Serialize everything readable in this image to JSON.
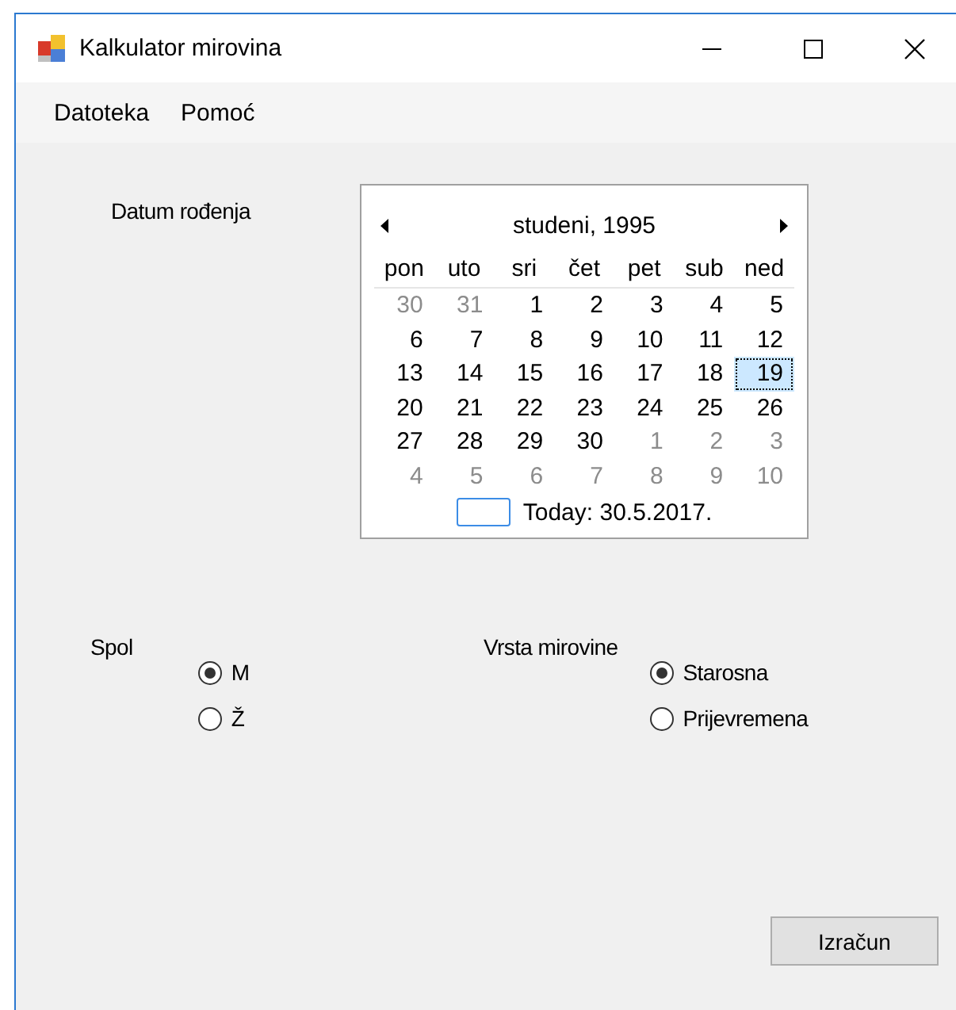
{
  "window": {
    "title": "Kalkulator mirovina"
  },
  "menu": [
    "Datoteka",
    "Pomoć"
  ],
  "birth_date": {
    "label": "Datum rođenja",
    "calendar": {
      "month": "studeni, 1995",
      "weekdays": [
        "pon",
        "uto",
        "sri",
        "čet",
        "pet",
        "sub",
        "ned"
      ],
      "weeks": [
        [
          {
            "day": "30",
            "muted": true,
            "selected": false
          },
          {
            "day": "31",
            "muted": true,
            "selected": false
          },
          {
            "day": "1",
            "muted": false,
            "selected": false
          },
          {
            "day": "2",
            "muted": false,
            "selected": false
          },
          {
            "day": "3",
            "muted": false,
            "selected": false
          },
          {
            "day": "4",
            "muted": false,
            "selected": false
          },
          {
            "day": "5",
            "muted": false,
            "selected": false
          }
        ],
        [
          {
            "day": "6",
            "muted": false,
            "selected": false
          },
          {
            "day": "7",
            "muted": false,
            "selected": false
          },
          {
            "day": "8",
            "muted": false,
            "selected": false
          },
          {
            "day": "9",
            "muted": false,
            "selected": false
          },
          {
            "day": "10",
            "muted": false,
            "selected": false
          },
          {
            "day": "11",
            "muted": false,
            "selected": false
          },
          {
            "day": "12",
            "muted": false,
            "selected": false
          }
        ],
        [
          {
            "day": "13",
            "muted": false,
            "selected": false
          },
          {
            "day": "14",
            "muted": false,
            "selected": false
          },
          {
            "day": "15",
            "muted": false,
            "selected": false
          },
          {
            "day": "16",
            "muted": false,
            "selected": false
          },
          {
            "day": "17",
            "muted": false,
            "selected": false
          },
          {
            "day": "18",
            "muted": false,
            "selected": false
          },
          {
            "day": "19",
            "muted": false,
            "selected": true
          }
        ],
        [
          {
            "day": "20",
            "muted": false,
            "selected": false
          },
          {
            "day": "21",
            "muted": false,
            "selected": false
          },
          {
            "day": "22",
            "muted": false,
            "selected": false
          },
          {
            "day": "23",
            "muted": false,
            "selected": false
          },
          {
            "day": "24",
            "muted": false,
            "selected": false
          },
          {
            "day": "25",
            "muted": false,
            "selected": false
          },
          {
            "day": "26",
            "muted": false,
            "selected": false
          }
        ],
        [
          {
            "day": "27",
            "muted": false,
            "selected": false
          },
          {
            "day": "28",
            "muted": false,
            "selected": false
          },
          {
            "day": "29",
            "muted": false,
            "selected": false
          },
          {
            "day": "30",
            "muted": false,
            "selected": false
          },
          {
            "day": "1",
            "muted": true,
            "selected": false
          },
          {
            "day": "2",
            "muted": true,
            "selected": false
          },
          {
            "day": "3",
            "muted": true,
            "selected": false
          }
        ],
        [
          {
            "day": "4",
            "muted": true,
            "selected": false
          },
          {
            "day": "5",
            "muted": true,
            "selected": false
          },
          {
            "day": "6",
            "muted": true,
            "selected": false
          },
          {
            "day": "7",
            "muted": true,
            "selected": false
          },
          {
            "day": "8",
            "muted": true,
            "selected": false
          },
          {
            "day": "9",
            "muted": true,
            "selected": false
          },
          {
            "day": "10",
            "muted": true,
            "selected": false
          }
        ]
      ],
      "today": "Today: 30.5.2017."
    }
  },
  "groups": [
    {
      "label": "Spol",
      "options": [
        {
          "label": "M",
          "selected": true
        },
        {
          "label": "Ž",
          "selected": false
        }
      ]
    },
    {
      "label": "Vrsta mirovine",
      "options": [
        {
          "label": "Starosna",
          "selected": true
        },
        {
          "label": "Prijevremena",
          "selected": false
        }
      ]
    }
  ],
  "button": "Izračun"
}
